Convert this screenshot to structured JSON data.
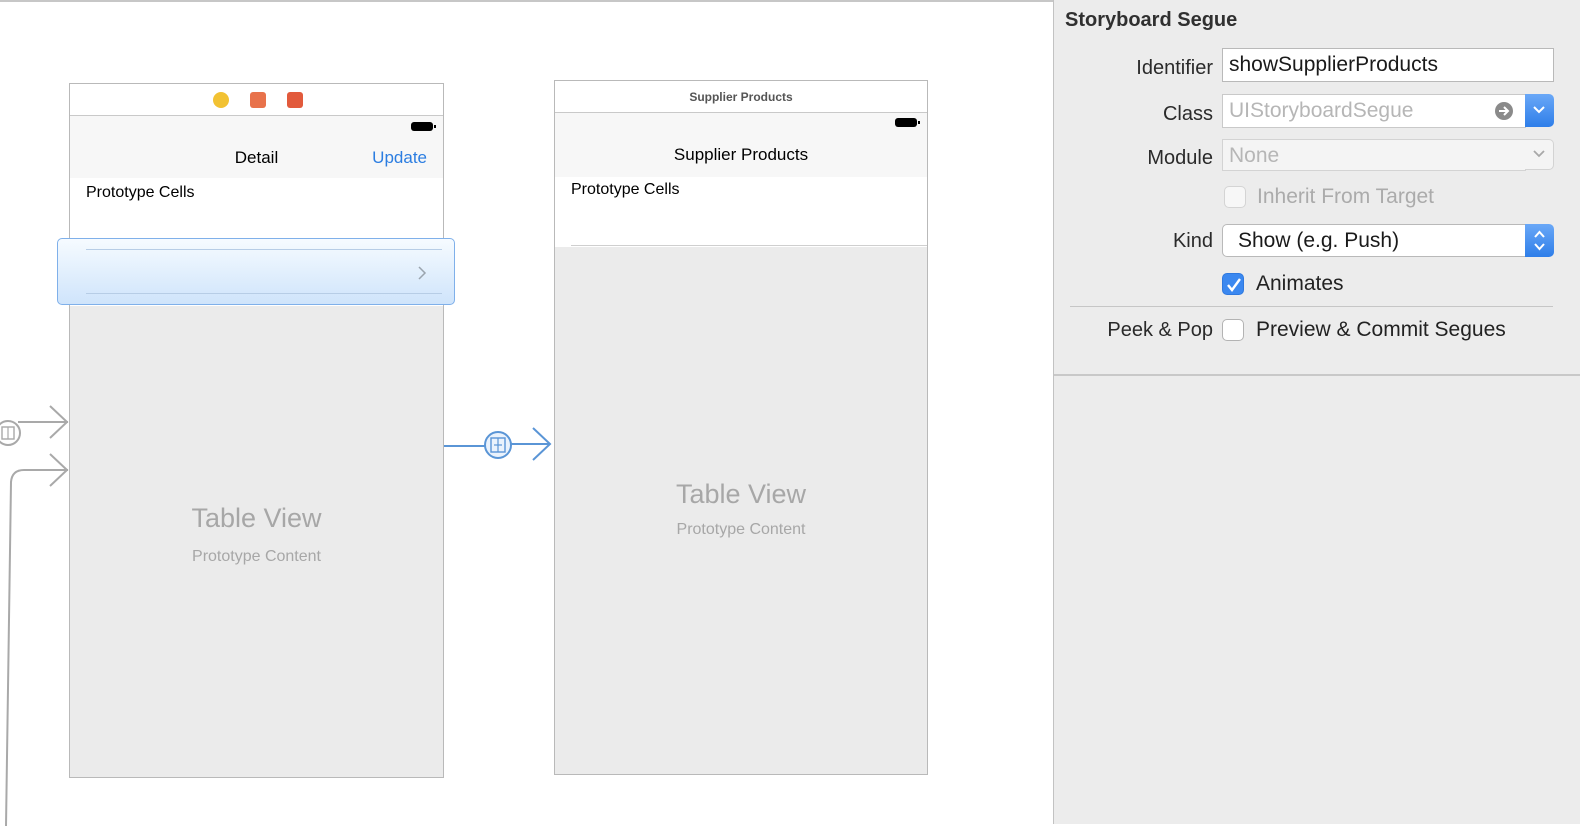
{
  "canvas": {
    "detail_scene": {
      "title": "Detail",
      "right_button": "Update",
      "section_label": "Prototype Cells",
      "table_title": "Table View",
      "table_subtitle": "Prototype Content"
    },
    "supplier_scene": {
      "bar_title": "Supplier Products",
      "title": "Supplier Products",
      "section_label": "Prototype Cells",
      "table_title": "Table View",
      "table_subtitle": "Prototype Content"
    }
  },
  "inspector": {
    "title": "Storyboard Segue",
    "identifier_label": "Identifier",
    "identifier_value": "showSupplierProducts",
    "class_label": "Class",
    "class_placeholder": "UIStoryboardSegue",
    "module_label": "Module",
    "module_placeholder": "None",
    "inherit_label": "Inherit From Target",
    "kind_label": "Kind",
    "kind_value": "Show (e.g. Push)",
    "animates_label": "Animates",
    "animates_checked": true,
    "peek_label": "Peek & Pop",
    "preview_label": "Preview & Commit Segues",
    "preview_checked": false
  },
  "colors": {
    "accent": "#2b7de1",
    "segue_selected": "#5a95d6",
    "segue_inactive": "#a9a9a9"
  }
}
